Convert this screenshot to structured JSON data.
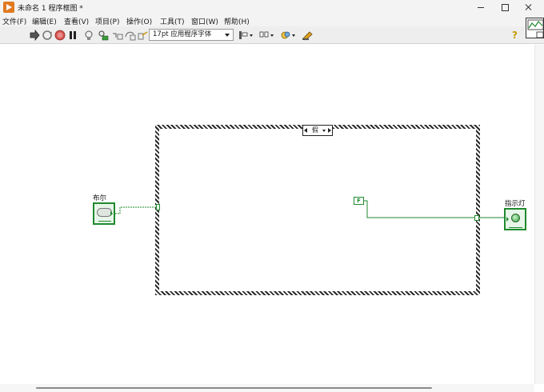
{
  "window": {
    "title": "未命名 1 程序框图 *"
  },
  "menu": {
    "items": [
      {
        "label": "文件(F)"
      },
      {
        "label": "编辑(E)"
      },
      {
        "label": "查看(V)"
      },
      {
        "label": "项目(P)"
      },
      {
        "label": "操作(O)"
      },
      {
        "label": "工具(T)"
      },
      {
        "label": "窗口(W)"
      },
      {
        "label": "帮助(H)"
      }
    ]
  },
  "toolbar": {
    "buttons": [
      {
        "icon": "run-arrow-icon"
      },
      {
        "icon": "run-continuous-icon"
      },
      {
        "icon": "abort-icon"
      },
      {
        "icon": "pause-icon"
      },
      {
        "icon": "highlight-execution-icon"
      },
      {
        "icon": "retain-wire-values-icon"
      },
      {
        "icon": "step-into-icon"
      },
      {
        "icon": "step-over-icon"
      },
      {
        "icon": "step-out-icon"
      }
    ],
    "font": {
      "value": "17pt 应用程序字体"
    },
    "align_icon": "align-objects-icon",
    "distribute_icon": "distribute-objects-icon",
    "reorder_icon": "reorder-icon",
    "cleanup_icon": "cleanup-diagram-icon",
    "help_icon": "help-icon",
    "colors": {
      "abort": "#d9534f",
      "run": "#333333"
    }
  },
  "diagram": {
    "case_selector": {
      "value": "假"
    },
    "bool_control": {
      "label": "布尔"
    },
    "led_indicator": {
      "label": "指示灯"
    },
    "false_constant": {
      "text": "F"
    },
    "colors": {
      "boolean_wire": "#1f8a2e",
      "structure_border": "#2b2b2b"
    }
  }
}
